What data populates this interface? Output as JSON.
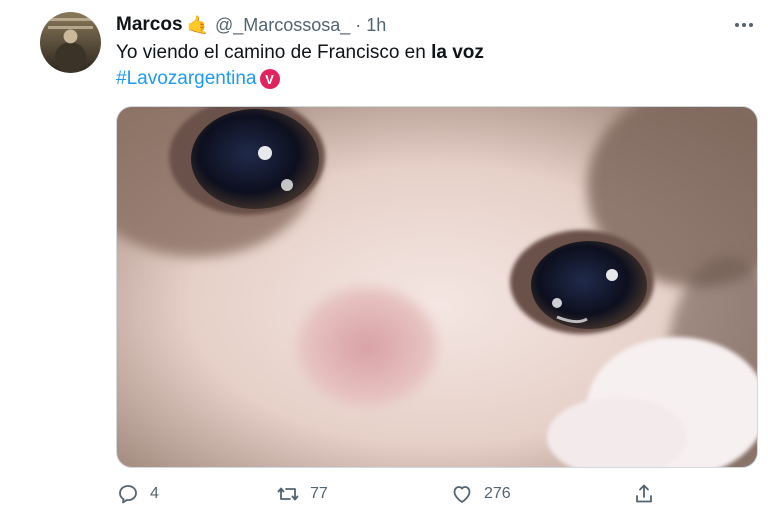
{
  "tweet": {
    "display_name": "Marcos",
    "badge_emoji": "🤙",
    "handle": "@_Marcossosa_",
    "separator": "·",
    "time": "1h",
    "text_plain": "Yo viendo el camino de Francisco en ",
    "text_bold": "la voz",
    "hashtag": "#Lavozargentina",
    "hashtag_emoji": "V",
    "media_description": "crying cat meme photo",
    "more_icon": "more-dots-icon"
  },
  "actions": {
    "reply": {
      "icon": "reply-icon",
      "count": "4"
    },
    "retweet": {
      "icon": "retweet-icon",
      "count": "77"
    },
    "like": {
      "icon": "like-icon",
      "count": "276"
    },
    "share": {
      "icon": "share-icon"
    }
  },
  "colors": {
    "link": "#1d9bf0",
    "secondary_text": "#536471",
    "primary_text": "#0f1419",
    "border": "#cfd9de",
    "hashtag_badge": "#e0245e"
  }
}
